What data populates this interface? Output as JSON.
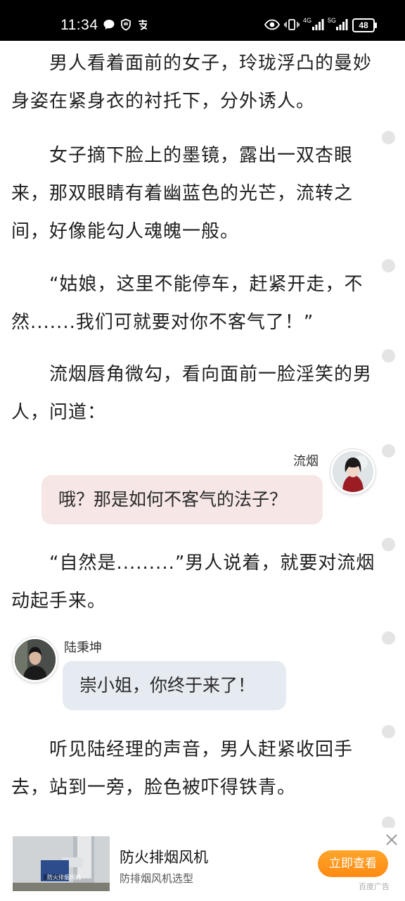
{
  "status_bar": {
    "time": "11:34",
    "network_1": "4G",
    "network_2": "5G",
    "battery": "48"
  },
  "story": {
    "p1": "男人看着面前的女子，玲珑浮凸的曼妙身姿在紧身衣的衬托下，分外诱人。",
    "p2": "女子摘下脸上的墨镜，露出一双杏眼来，那双眼睛有着幽蓝色的光芒，流转之间，好像能勾人魂魄一般。",
    "p3": "“姑娘，这里不能停车，赶紧开走，不然.......我们可就要对你不客气了！”",
    "p4": "流烟唇角微勾，看向面前一脸淫笑的男人，问道：",
    "chat1": {
      "name": "流烟",
      "text": "哦？那是如何不客气的法子？"
    },
    "p5": "“自然是.........”男人说着，就要对流烟动起手来。",
    "chat2": {
      "name": "陆秉坤",
      "text": "崇小姐，你终于来了！"
    },
    "p6": "听见陆经理的声音，男人赶紧收回手去，站到一旁，脸色被吓得铁青。"
  },
  "ad": {
    "title": "防火排烟风机",
    "subtitle": "防排烟风机选型",
    "button": "立即查看",
    "tag": "百度广告",
    "thumb_caption": "防火排烟风机"
  },
  "colors": {
    "accent_button": "#ff9a1f",
    "bubble_pink": "#f6e7e6",
    "bubble_blue": "#e6ebf2"
  }
}
